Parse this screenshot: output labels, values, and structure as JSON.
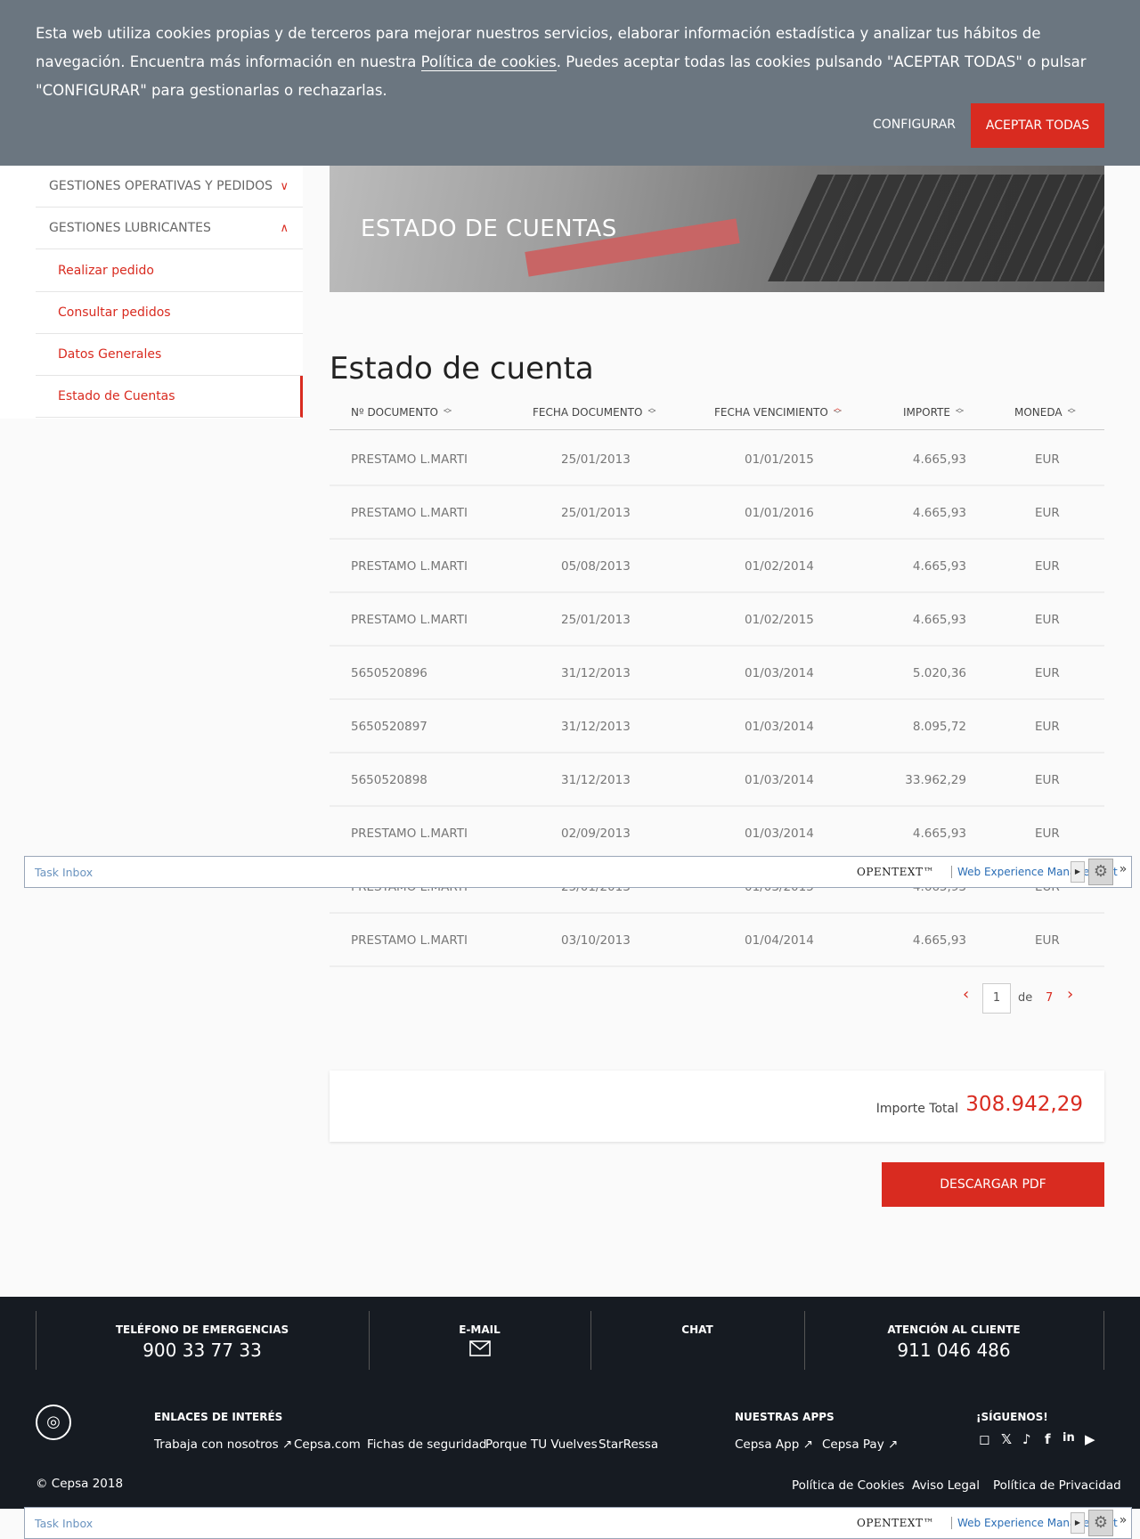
{
  "cookie": {
    "text_before": "Esta web utiliza cookies propias y de terceros para mejorar nuestros servicios, elaborar información estadística y analizar tus hábitos de navegación. Encuentra más información en nuestra ",
    "link": "Política de cookies",
    "text_after": ". Puedes aceptar todas las cookies pulsando \"ACEPTAR TODAS\" o pulsar \"CONFIGURAR\" para gestionarlas o rechazarlas.",
    "config_label": "CONFIGURAR",
    "accept_label": "ACEPTAR TODAS"
  },
  "sidebar": {
    "sections": [
      {
        "label": "GESTIONES OPERATIVAS Y PEDIDOS",
        "chevron": "∨"
      },
      {
        "label": "GESTIONES LUBRICANTES",
        "chevron": "∧"
      }
    ],
    "items": [
      {
        "label": "Realizar pedido"
      },
      {
        "label": "Consultar pedidos"
      },
      {
        "label": "Datos Generales"
      },
      {
        "label": "Estado de Cuentas"
      }
    ]
  },
  "banner": {
    "title": "ESTADO DE CUENTAS"
  },
  "page_title": "Estado de cuenta",
  "table": {
    "columns": [
      "Nº DOCUMENTO",
      "FECHA DOCUMENTO",
      "FECHA VENCIMIENTO",
      "IMPORTE",
      "MONEDA"
    ],
    "rows": [
      [
        "PRESTAMO L.MARTI",
        "25/01/2013",
        "01/01/2015",
        "4.665,93",
        "EUR"
      ],
      [
        "PRESTAMO L.MARTI",
        "25/01/2013",
        "01/01/2016",
        "4.665,93",
        "EUR"
      ],
      [
        "PRESTAMO L.MARTI",
        "05/08/2013",
        "01/02/2014",
        "4.665,93",
        "EUR"
      ],
      [
        "PRESTAMO L.MARTI",
        "25/01/2013",
        "01/02/2015",
        "4.665,93",
        "EUR"
      ],
      [
        "5650520896",
        "31/12/2013",
        "01/03/2014",
        "5.020,36",
        "EUR"
      ],
      [
        "5650520897",
        "31/12/2013",
        "01/03/2014",
        "8.095,72",
        "EUR"
      ],
      [
        "5650520898",
        "31/12/2013",
        "01/03/2014",
        "33.962,29",
        "EUR"
      ],
      [
        "PRESTAMO L.MARTI",
        "02/09/2013",
        "01/03/2014",
        "4.665,93",
        "EUR"
      ],
      [
        "PRESTAMO L.MARTI",
        "25/01/2013",
        "01/03/2015",
        "4.665,93",
        "EUR"
      ],
      [
        "PRESTAMO L.MARTI",
        "03/10/2013",
        "01/04/2014",
        "4.665,93",
        "EUR"
      ]
    ]
  },
  "pager": {
    "current": "1",
    "de": "de",
    "total": "7"
  },
  "total": {
    "label": "Importe Total",
    "value": "308.942,29"
  },
  "pdf_label": "DESCARGAR PDF",
  "taskbar": {
    "label": "Task Inbox",
    "brand": "OPENTEXT™",
    "product": "Web Experience Management"
  },
  "footer": {
    "contacts": [
      {
        "title": "TELÉFONO DE EMERGENCIAS",
        "value": "900 33 77 33"
      },
      {
        "title": "E-MAIL",
        "value": ""
      },
      {
        "title": "CHAT",
        "value": ""
      },
      {
        "title": "ATENCIÓN AL CLIENTE",
        "value": "911 046 486"
      }
    ],
    "links_title": "ENLACES DE INTERÉS",
    "links": [
      "Trabaja con nosotros",
      "Cepsa.com",
      "Fichas de seguridad",
      "Porque TU Vuelves",
      "StarRessa"
    ],
    "apps_title": "NUESTRAS APPS",
    "apps": [
      "Cepsa App",
      "Cepsa Pay"
    ],
    "follow_title": "¡SÍGUENOS!",
    "social_icons": [
      "instagram-icon",
      "x-icon",
      "tiktok-icon",
      "facebook-icon",
      "linkedin-icon",
      "youtube-icon"
    ],
    "copyright": "© Cepsa 2018",
    "legal": [
      "Política de Cookies",
      "Aviso Legal",
      "Política de Privacidad"
    ]
  }
}
